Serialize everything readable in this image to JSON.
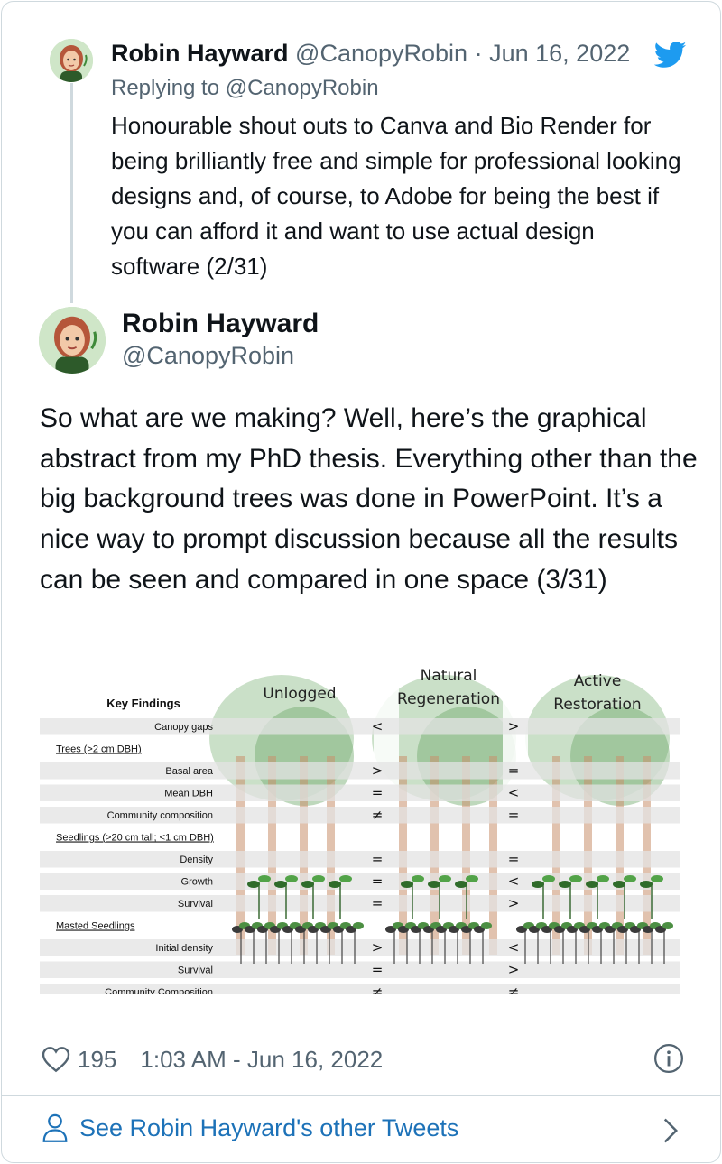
{
  "reply_tweet": {
    "name": "Robin Hayward",
    "handle": "@CanopyRobin",
    "separator": "·",
    "date": "Jun 16, 2022",
    "replying_prefix": "Replying to",
    "replying_to": "@CanopyRobin",
    "text": "Honourable shout outs to Canva and Bio Render for being brilliantly free and simple for professional looking designs and, of course, to Adobe for being the best if you can afford it and want to use actual design software (2/31)"
  },
  "main_tweet": {
    "name": "Robin Hayward",
    "handle": "@CanopyRobin",
    "text": "So what are we making? Well, here’s the graphical abstract from my PhD thesis. Everything other than the big background trees was done in PowerPoint. It’s a nice way to prompt discussion because all the results can be seen and compared in one space (3/31)",
    "likes": "195",
    "timestamp": "1:03 AM - Jun 16, 2022"
  },
  "figure": {
    "header": "Key Findings",
    "columns": [
      "Unlogged",
      "Natural Regeneration",
      "Active Restoration"
    ],
    "rows": [
      {
        "label": "Canopy gaps",
        "kind": "row",
        "c1": "<",
        "c2": ">"
      },
      {
        "label": "Trees (>2 cm DBH)",
        "kind": "section"
      },
      {
        "label": "Basal area",
        "kind": "row",
        "c1": ">",
        "c2": "="
      },
      {
        "label": "Mean DBH",
        "kind": "row",
        "c1": "=",
        "c2": "<"
      },
      {
        "label": "Community composition",
        "kind": "row",
        "c1": "≠",
        "c2": "="
      },
      {
        "label": "Seedlings (>20 cm tall; <1 cm DBH)",
        "kind": "section"
      },
      {
        "label": "Density",
        "kind": "row",
        "c1": "=",
        "c2": "="
      },
      {
        "label": "Growth",
        "kind": "row",
        "c1": "=",
        "c2": "<"
      },
      {
        "label": "Survival",
        "kind": "row",
        "c1": "=",
        "c2": ">"
      },
      {
        "label": "Masted Seedlings",
        "kind": "section"
      },
      {
        "label": "Initial density",
        "kind": "row",
        "c1": ">",
        "c2": "<"
      },
      {
        "label": "Survival",
        "kind": "row",
        "c1": "=",
        "c2": ">"
      },
      {
        "label": "Community Composition",
        "kind": "row",
        "c1": "≠",
        "c2": "≠"
      }
    ]
  },
  "footer": {
    "see_more": "See Robin Hayward's other Tweets"
  },
  "colors": {
    "twitter_blue": "#1d9bf0",
    "link_blue": "#1d72b8",
    "muted_text": "#536471"
  },
  "icons": [
    "twitter-bird-icon",
    "heart-icon",
    "info-icon",
    "person-icon",
    "chevron-right-icon"
  ]
}
